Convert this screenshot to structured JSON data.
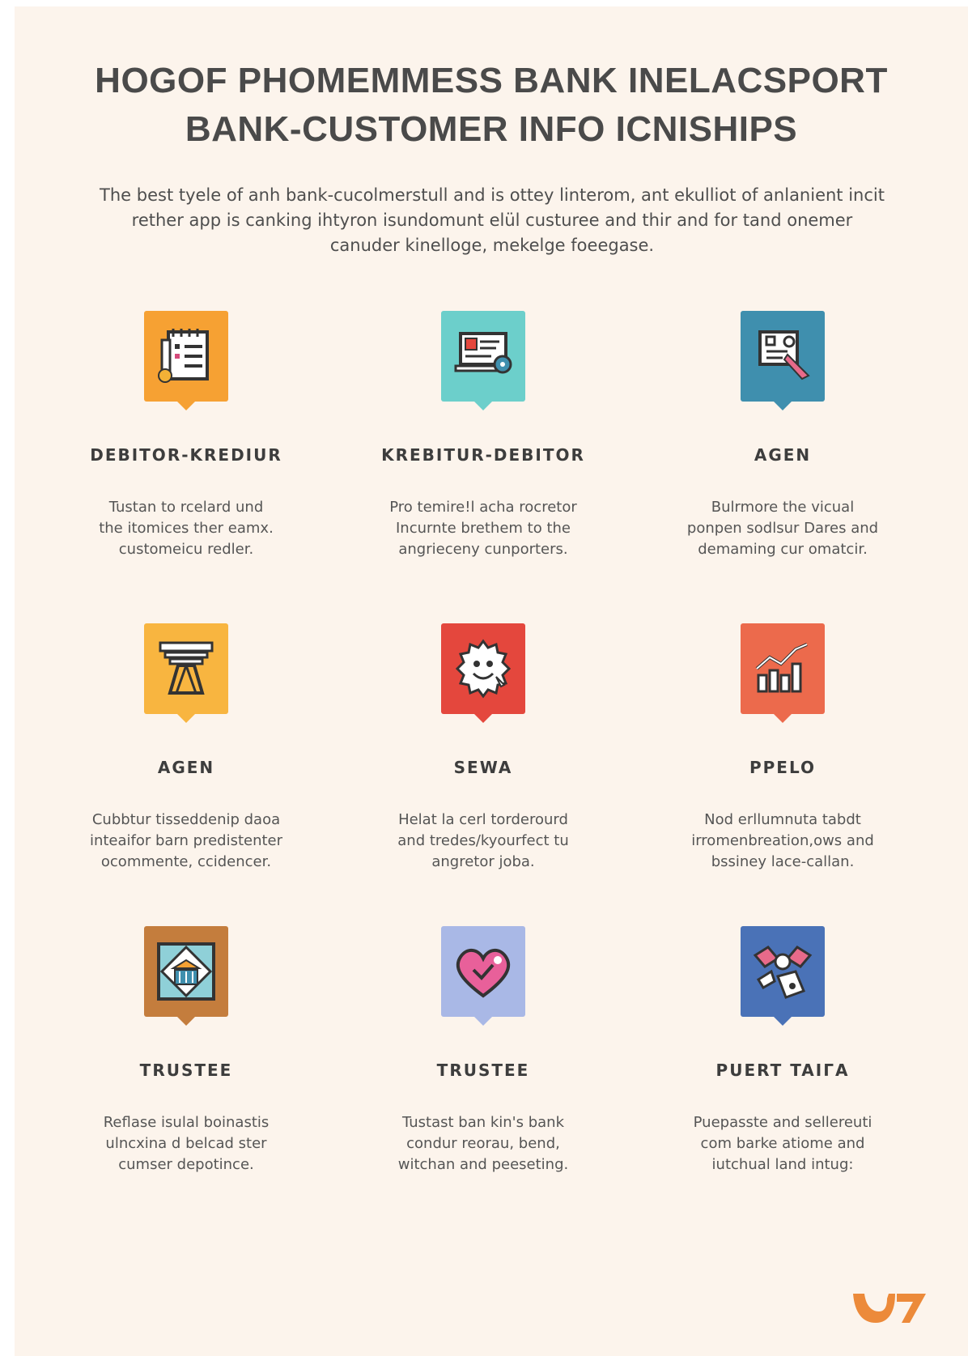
{
  "header": {
    "title_line1": "HOGOF PHOMEMMESS BANK INELACSPORT",
    "title_line2": "BANK-CUSTOMER INFO ICNISHIPS",
    "intro_line1": "The best tyele of anh bank-cucolmerstull and is ottey linterom, ant ekulliot of anlanient incit",
    "intro_line2": "rether app is canking ihtyron isundomunt elül custuree and thir and for tand onemer",
    "intro_line3": "canuder kinelloge, mekelge foeegase."
  },
  "cards": [
    {
      "icon": "clipboard-checklist-icon",
      "color": "#f6a133",
      "title": "DEBITOR-KREDIUR",
      "desc": [
        "Tustan to rcelard und",
        "the itomices ther eamx.",
        "customeicu redler."
      ]
    },
    {
      "icon": "computer-monitor-gear-icon",
      "color": "#6ccfcb",
      "title": "KREBITUR-DEBITOR",
      "desc": [
        "Pro temire!l acha rocretor",
        "Incurnte brethem to the",
        "angrieceny cunporters."
      ]
    },
    {
      "icon": "document-pointer-icon",
      "color": "#3f8fae",
      "title": "AGEN",
      "desc": [
        "Bulrmore the vicual",
        "ponpen sodlsur Dares and",
        "demaming cur omatcir."
      ]
    },
    {
      "icon": "pillar-column-icon",
      "color": "#f8b540",
      "title": "AGEN",
      "desc": [
        "Cubbtur tisseddenip daoa",
        "inteaifor barn predistenter",
        "ocommente, ccidencer."
      ]
    },
    {
      "icon": "smiling-gear-icon",
      "color": "#e4473d",
      "title": "SEWA",
      "desc": [
        "Helat la cerl torderourd",
        "and tredes/kyourfect tu",
        "angretor joba."
      ]
    },
    {
      "icon": "bar-chart-trend-icon",
      "color": "#ec6a4c",
      "title": "PPELO",
      "desc": [
        "Nod erllumnuta tabdt",
        "irromenbreation,ows and",
        "bssiney lace-callan."
      ]
    },
    {
      "icon": "bank-building-icon",
      "color": "#c47d3d",
      "title": "TRUSTEE",
      "desc": [
        "Reflase isulal boinastis",
        "ulncxina d belcad ster",
        "cumser depotince."
      ]
    },
    {
      "icon": "heart-check-icon",
      "color": "#a9b8e6",
      "title": "TRUSTEE",
      "desc": [
        "Tustast ban kin's bank",
        "condur reorau, bend,",
        "witchan and peeseting."
      ]
    },
    {
      "icon": "handshake-deal-icon",
      "color": "#4a72b7",
      "title": "PUERT TAIΓA",
      "desc": [
        "Puepasste and sellereuti",
        "com barke atiome and",
        "iutchual land intug:"
      ]
    }
  ],
  "footer": {
    "logo_text": "U7",
    "logo_color": "#ec8a3a"
  }
}
